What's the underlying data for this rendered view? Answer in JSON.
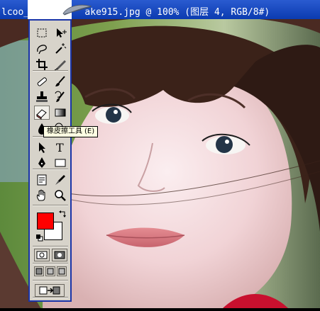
{
  "window": {
    "title_left": "lcoo_c",
    "title_right": "ake915.jpg @ 100% (图层 4, RGB/8#)"
  },
  "toolbox": {
    "tools": [
      {
        "name": "rect-marquee-icon",
        "row": 0,
        "col": "l"
      },
      {
        "name": "move-icon",
        "row": 0,
        "col": "r"
      },
      {
        "name": "lasso-icon",
        "row": 1,
        "col": "l"
      },
      {
        "name": "magic-wand-icon",
        "row": 1,
        "col": "r"
      },
      {
        "name": "crop-icon",
        "row": 2,
        "col": "l"
      },
      {
        "name": "slice-icon",
        "row": 2,
        "col": "r"
      },
      {
        "name": "healing-brush-icon",
        "row": 3,
        "col": "l"
      },
      {
        "name": "brush-icon",
        "row": 3,
        "col": "r"
      },
      {
        "name": "clone-stamp-icon",
        "row": 4,
        "col": "l"
      },
      {
        "name": "history-brush-icon",
        "row": 4,
        "col": "r"
      },
      {
        "name": "eraser-icon",
        "row": 5,
        "col": "l"
      },
      {
        "name": "gradient-icon",
        "row": 5,
        "col": "r"
      },
      {
        "name": "blur-icon",
        "row": 6,
        "col": "l"
      },
      {
        "name": "dodge-icon",
        "row": 6,
        "col": "r"
      },
      {
        "name": "path-select-icon",
        "row": 7,
        "col": "l"
      },
      {
        "name": "type-icon",
        "row": 7,
        "col": "r"
      },
      {
        "name": "pen-icon",
        "row": 8,
        "col": "l"
      },
      {
        "name": "shape-icon",
        "row": 8,
        "col": "r"
      },
      {
        "name": "notes-icon",
        "row": 9,
        "col": "l"
      },
      {
        "name": "eyedropper-icon",
        "row": 9,
        "col": "r"
      },
      {
        "name": "hand-icon",
        "row": 10,
        "col": "l"
      },
      {
        "name": "zoom-icon",
        "row": 10,
        "col": "r"
      }
    ],
    "active_tool": "eraser-icon",
    "foreground_color": "#ff0000",
    "background_color": "#ffffff",
    "accent": "#1a34a8"
  },
  "tooltip": {
    "label": "橡皮擦工具",
    "shortcut": "(E)"
  }
}
